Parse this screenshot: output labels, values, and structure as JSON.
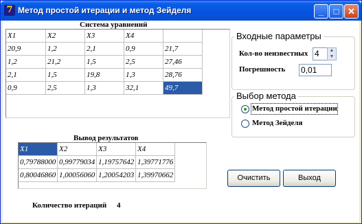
{
  "window": {
    "title": "Метод простой итерации и метод Зейделя",
    "icon": "delphi-app-icon",
    "icon_glyph": "7",
    "controls": {
      "minimize": "_",
      "maximize": "□",
      "close": "✕"
    }
  },
  "system": {
    "label": "Система уравнений",
    "headers": [
      "X1",
      "X2",
      "X3",
      "X4",
      ""
    ],
    "rows": [
      [
        "20,9",
        "1,2",
        "2,1",
        "0,9",
        "21,7"
      ],
      [
        "1,2",
        "21,2",
        "1,5",
        "2,5",
        "27,46"
      ],
      [
        "2,1",
        "1,5",
        "19,8",
        "1,3",
        "28,76"
      ],
      [
        "0,9",
        "2,5",
        "1,3",
        "32,1",
        "49,7"
      ]
    ],
    "selected_cell": "row 4, column 5"
  },
  "params": {
    "legend": "Входные параметры",
    "count_label": "Кол-во неизвестных",
    "count_value": "4",
    "precision_label": "Погрешность",
    "precision_value": "0,01"
  },
  "method": {
    "legend": "Выбор метода",
    "options": [
      "Метод простой итерации",
      "Метод Зейделя"
    ],
    "selected": "Метод простой итерации"
  },
  "results": {
    "label": "Вывод результатов",
    "headers": [
      "X1",
      "X2",
      "X3",
      "X4"
    ],
    "rows": [
      [
        "0,79788000",
        "0,99779034",
        "1,19757642",
        "1,39771776"
      ],
      [
        "0,80046860",
        "1,00056060",
        "1,20054203",
        "1,39970662"
      ]
    ]
  },
  "buttons": {
    "clear": "Очистить",
    "exit": "Выход"
  },
  "iterations": {
    "label": "Количество итераций",
    "value": "4"
  },
  "colors": {
    "titlebar": "#0553e0",
    "selection": "#2a5aa8",
    "window_border": "#0831d9",
    "radio_dot": "#21a121"
  }
}
